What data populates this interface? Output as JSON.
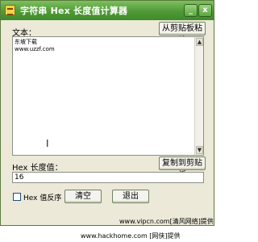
{
  "window": {
    "title": "字符串 Hex 长度值计算器",
    "minimize_label": "_",
    "close_label": "x"
  },
  "text_section": {
    "label": "文本：",
    "paste_button": "从剪贴板粘贴",
    "content_lines": [
      "东坡下载",
      "www.uzzf.com"
    ]
  },
  "hex_section": {
    "label": "Hex 长度值：",
    "copy_button": "复制到剪贴板",
    "value": "16"
  },
  "footer": {
    "reverse_checkbox_label": "Hex 值反序",
    "clear_button": "清空",
    "exit_button": "退出"
  },
  "watermarks": {
    "line1": "www.vipcn.com[清风网络]提供",
    "line2": "www.hackhome.com [网侠]提供"
  },
  "colors": {
    "titlebar": "#4f9a36",
    "window_bg": "#ece9d8"
  }
}
